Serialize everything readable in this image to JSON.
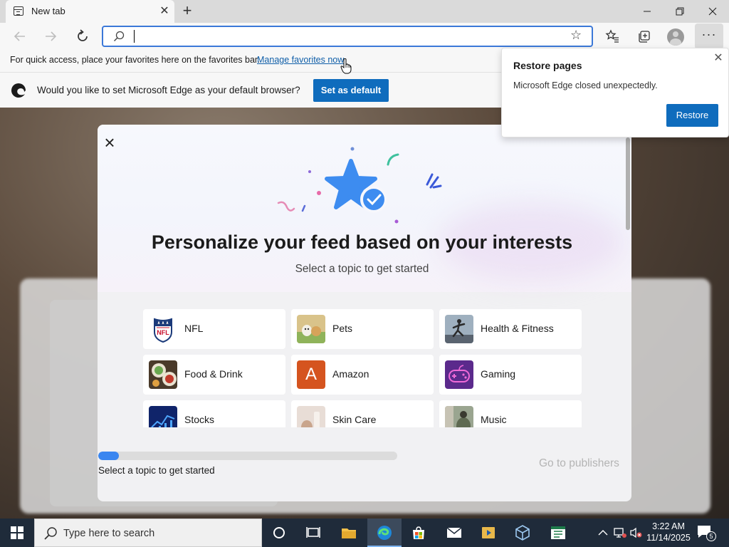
{
  "browser": {
    "tab_title": "New tab",
    "tab_close": "✕",
    "new_tab": "+",
    "window": {
      "minimize": "—",
      "maximize": "❐",
      "close": "✕"
    }
  },
  "toolbar": {
    "address_value": "",
    "address_placeholder": "",
    "more_label": "···"
  },
  "favorites_bar": {
    "text": "For quick access, place your favorites here on the favorites bar.",
    "link": "Manage favorites now"
  },
  "default_bar": {
    "message": "Would you like to set Microsoft Edge as your default browser?",
    "button": "Set as default"
  },
  "restore_popup": {
    "title": "Restore pages",
    "message": "Microsoft Edge closed unexpectedly.",
    "button": "Restore",
    "close": "✕"
  },
  "modal": {
    "close": "×",
    "heading": "Personalize your feed based on your interests",
    "subheading": "Select a topic to get started",
    "topics": [
      {
        "label": "NFL",
        "icon": "nfl-logo"
      },
      {
        "label": "Pets",
        "icon": "pets-photo"
      },
      {
        "label": "Health & Fitness",
        "icon": "fitness-photo"
      },
      {
        "label": "Food & Drink",
        "icon": "food-photo"
      },
      {
        "label": "Amazon",
        "icon": "amazon-letter",
        "letter": "A"
      },
      {
        "label": "Gaming",
        "icon": "gaming-controller"
      },
      {
        "label": "Stocks",
        "icon": "stocks-chart"
      },
      {
        "label": "Skin Care",
        "icon": "skincare-photo"
      },
      {
        "label": "Music",
        "icon": "music-photo"
      }
    ],
    "progress_fraction": 0.07,
    "progress_label": "Select a topic to get started",
    "next_button": "Go to publishers"
  },
  "taskbar": {
    "search_placeholder": "Type here to search",
    "time": "3:22 AM",
    "date": "11/14/2025",
    "notification_count": "5"
  },
  "colors": {
    "accent": "#0f6cbd",
    "progress": "#3a86f0",
    "taskbar": "#1f2b3a"
  }
}
